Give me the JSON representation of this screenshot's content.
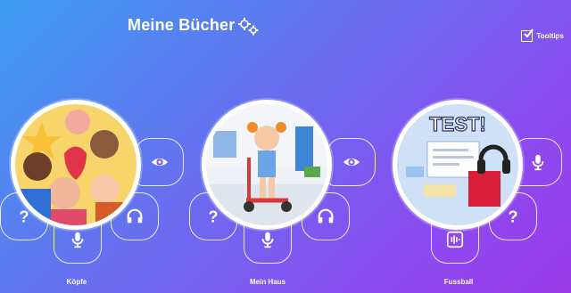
{
  "header": {
    "title": "Meine Bücher",
    "tooltips_label": "Tooltips"
  },
  "books": [
    {
      "title": "Köpfe"
    },
    {
      "title": "Mein Haus"
    },
    {
      "title": "Fussball"
    }
  ],
  "illustration_texts": {
    "test_banner": "TEST!"
  },
  "icons": {
    "settings": "gear-icon",
    "tooltips_toggle": "checkbox-icon",
    "read": "eye-icon",
    "help": "question-icon",
    "record": "microphone-icon",
    "listen": "headphones-icon",
    "audio_file": "audio-wave-icon"
  },
  "colors": {
    "background_start": "#3b9df0",
    "background_end": "#9a3ae8",
    "accent_white": "#ffffff"
  }
}
